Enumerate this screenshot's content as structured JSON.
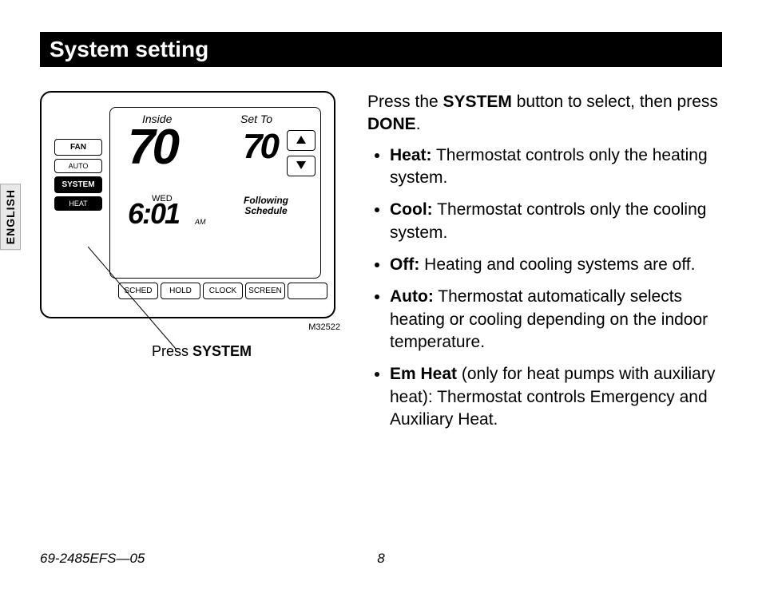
{
  "title": "System setting",
  "side_tab": "ENGLISH",
  "thermostat": {
    "inside_label": "Inside",
    "inside_temp": "70",
    "setto_label": "Set To",
    "set_temp": "70",
    "day": "WED",
    "time": "6:01",
    "ampm": "AM",
    "following_line1": "Following",
    "following_line2": "Schedule",
    "left_buttons": {
      "fan": "FAN",
      "auto": "AUTO",
      "system": "SYSTEM",
      "heat": "HEAT"
    },
    "bottom_buttons": {
      "sched": "SCHED",
      "hold": "HOLD",
      "clock": "CLOCK",
      "screen": "SCREEN"
    },
    "diagram_id": "M32522"
  },
  "callout": {
    "prefix": "Press ",
    "bold": "SYSTEM"
  },
  "instructions": {
    "intro_1": "Press the ",
    "intro_b1": "SYSTEM",
    "intro_2": " button to select, then press ",
    "intro_b2": "DONE",
    "intro_3": ".",
    "items": [
      {
        "bold": "Heat:",
        "text": " Thermostat controls only the heating system."
      },
      {
        "bold": "Cool:",
        "text": " Thermostat controls only the cooling system."
      },
      {
        "bold": "Off:",
        "text": " Heating and cooling systems are off."
      },
      {
        "bold": "Auto:",
        "text": " Thermostat automatically selects heating or cooling depending on the indoor temperature."
      },
      {
        "bold": "Em Heat",
        "text": " (only for heat pumps with auxiliary heat): Thermostat controls Emergency and Auxiliary Heat."
      }
    ]
  },
  "footer": {
    "docnum": "69-2485EFS—05",
    "page": "8"
  }
}
